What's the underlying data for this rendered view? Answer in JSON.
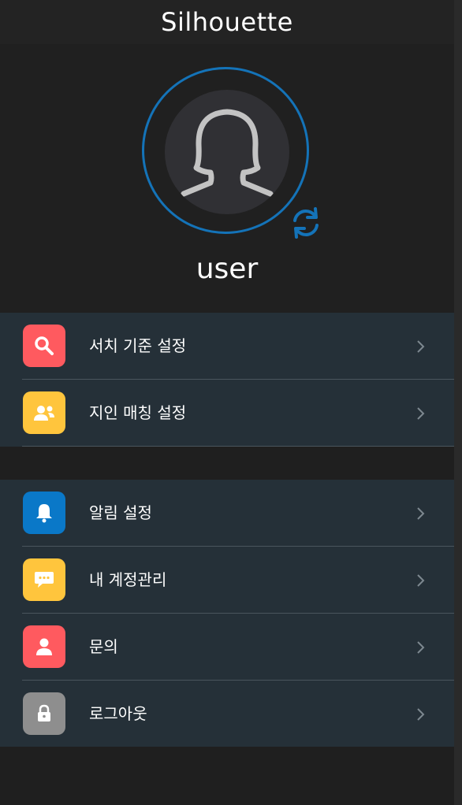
{
  "app": {
    "title": "Silhouette"
  },
  "profile": {
    "username": "user"
  },
  "colors": {
    "accent": "#1473b8",
    "background": "#1f1f1f",
    "row_background": "#253038",
    "red": "#ff5a5f",
    "yellow": "#ffc53d",
    "blue": "#0a78c8",
    "gray": "#8e8e8e"
  },
  "menu_groups": [
    {
      "items": [
        {
          "label": "서치 기준 설정",
          "icon": "search-icon",
          "icon_bg": "#ff5a5f"
        },
        {
          "label": "지인 매칭 설정",
          "icon": "people-icon",
          "icon_bg": "#ffc53d"
        }
      ]
    },
    {
      "items": [
        {
          "label": "알림 설정",
          "icon": "bell-icon",
          "icon_bg": "#0a78c8"
        },
        {
          "label": "내 계정관리",
          "icon": "chat-bubble-icon",
          "icon_bg": "#ffc53d"
        },
        {
          "label": "문의",
          "icon": "person-icon",
          "icon_bg": "#ff5a5f"
        },
        {
          "label": "로그아웃",
          "icon": "lock-icon",
          "icon_bg": "#8e8e8e"
        }
      ]
    }
  ]
}
